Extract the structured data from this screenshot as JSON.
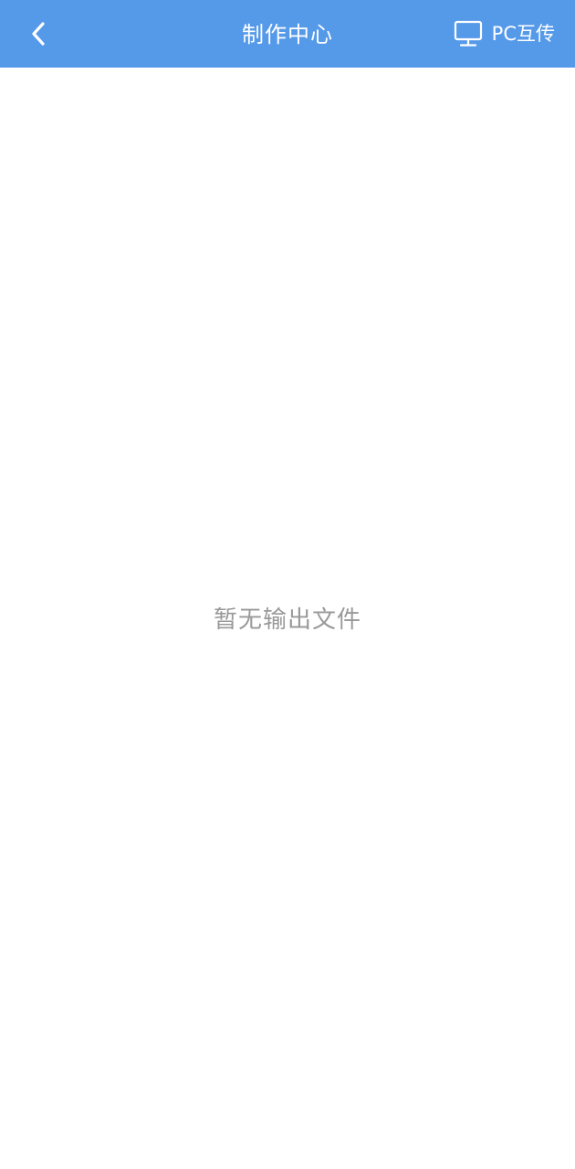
{
  "colors": {
    "header_bg": "#5599e9",
    "header_text": "#ffffff",
    "empty_text": "#999999",
    "page_bg": "#ffffff"
  },
  "header": {
    "back_icon": "chevron-left-icon",
    "title": "制作中心",
    "pc_transfer_icon": "monitor-icon",
    "pc_transfer_label": "PC互传"
  },
  "main": {
    "empty_message": "暂无输出文件"
  }
}
